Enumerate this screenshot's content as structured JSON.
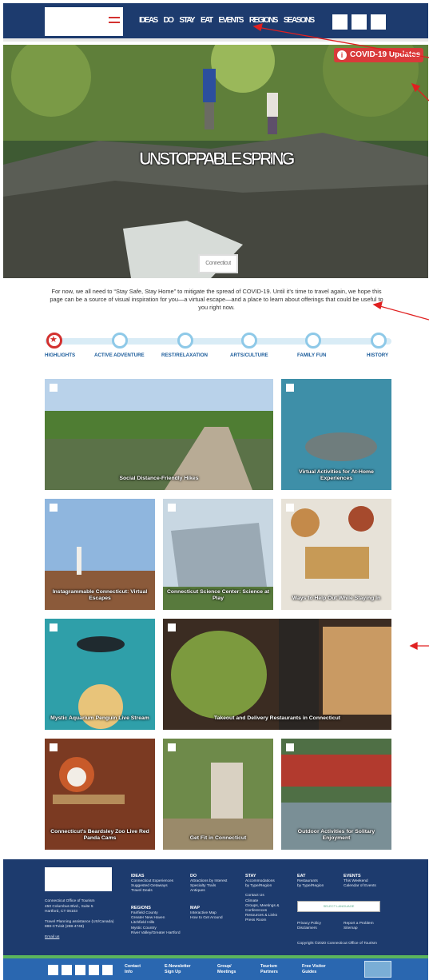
{
  "nav": {
    "items": [
      "IDEAS",
      "DO",
      "STAY",
      "EAT",
      "EVENTS",
      "REGIONS",
      "SEASONS"
    ]
  },
  "hero": {
    "covid_label": "COVID-19 Updates",
    "title": "UNSTOPPABLE SPRING",
    "badge": "Connecticut"
  },
  "intro": "For now, we all need to “Stay Safe, Stay Home” to mitigate the spread of COVID-19. Until it’s time to travel again, we hope this page can be a source of visual inspiration for you—a virtual escape—and a place to learn about offerings that could be useful to you right now.",
  "timeline": [
    "HIGHLIGHTS",
    "ACTIVE ADVENTURE",
    "REST/RELAXATION",
    "ARTS/CULTURE",
    "FAMILY FUN",
    "HISTORY"
  ],
  "cards": [
    {
      "caption": "Social Distance-Friendly Hikes"
    },
    {
      "caption": "Virtual Activities for At-Home Experiences"
    },
    {
      "caption": "Instagrammable Connecticut: Virtual Escapes"
    },
    {
      "caption": "Connecticut Science Center: Science at Play"
    },
    {
      "caption": "Ways to Help Out While Staying In"
    },
    {
      "caption": "Mystic Aquarium Penguin Live Stream"
    },
    {
      "caption": "Takeout and Delivery Restaurants in Connecticut"
    },
    {
      "caption": "Connecticut's Beardsley Zoo Live Red Panda Cams"
    },
    {
      "caption": "Get Fit in Connecticut"
    },
    {
      "caption": "Outdoor Activities for Solitary Enjoyment"
    }
  ],
  "footer": {
    "address": [
      "Connecticut Office of Tourism",
      "450 Columbus Blvd., Suite 5",
      "Hartford, CT 06103",
      "",
      "Travel Planning assistance (US/Canada)",
      "888-CTvisit (288-4748)",
      "",
      "Email us"
    ],
    "ideas": {
      "title": "IDEAS",
      "links": [
        "Connecticut Experiences",
        "Suggested Getaways",
        "Travel Deals"
      ]
    },
    "regions": {
      "title": "REGIONS",
      "links": [
        "Fairfield County",
        "Greater New Haven",
        "Litchfield Hills",
        "Mystic Country",
        "River Valley/Greater Hartford"
      ]
    },
    "do": {
      "title": "DO",
      "links": [
        "Attractions by Interest",
        "Specialty Trails",
        "Antiques"
      ]
    },
    "map": {
      "title": "MAP",
      "links": [
        "Interactive Map",
        "How to Get Around"
      ]
    },
    "stay": {
      "title": "STAY",
      "links": [
        "Accommodations",
        "by Type/Region",
        "",
        "Contact Us",
        "Climate",
        "Groups, Meetings &",
        "Conferences",
        "Resources & Links",
        "Press Room"
      ]
    },
    "eat": {
      "title": "EAT",
      "links": [
        "Restaurants",
        "by Type/Region"
      ]
    },
    "events": {
      "title": "EVENTS",
      "links": [
        "This Weekend",
        "Calendar of Events"
      ]
    },
    "language": "SELECT LANGUAGE",
    "legal1": [
      "Privacy Policy",
      "Disclaimers"
    ],
    "legal2": [
      "Report a Problem",
      "Sitemap"
    ],
    "copyright": "Copyright ©2020 Connecticut Office of Tourism"
  },
  "bottom_bar": [
    [
      "Contact",
      "Info"
    ],
    [
      "E-Newsletter",
      "Sign Up"
    ],
    [
      "Group/",
      "Meetings"
    ],
    [
      "Tourism",
      "Partners"
    ],
    [
      "Free Visitor",
      "Guides"
    ]
  ],
  "colors": {
    "navy": "#1d3b6e",
    "red": "#d3312f",
    "blue": "#2a67b0",
    "green": "#5bb55b"
  }
}
